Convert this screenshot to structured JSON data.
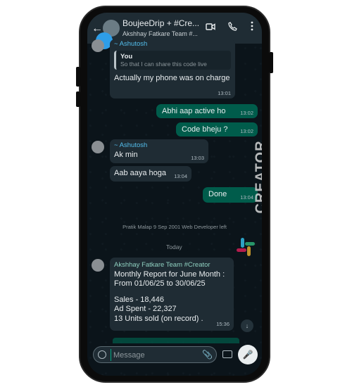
{
  "header": {
    "title": "BoujeeDrip + #Cre...",
    "subtitle": "Akshhay Fatkare Team #..."
  },
  "messages": {
    "m1": {
      "sender": "~ Ashutosh",
      "quote_author": "You",
      "quote_text": "So that I can share this code live",
      "text": "Actually my phone was on charge",
      "time": "13:01"
    },
    "m2": {
      "text": "Abhi aap active ho",
      "time": "13:02"
    },
    "m3": {
      "text": "Code bheju ?",
      "time": "13:02"
    },
    "m4": {
      "sender": "~ Ashutosh",
      "text": "Ak min",
      "time": "13:03"
    },
    "m5": {
      "text": "Aab aaya hoga",
      "time": "13:04"
    },
    "m6": {
      "text": "Done",
      "time": "13:04"
    },
    "system": "Pratik Malap 9 Sep 2001 Web Developer left",
    "day": "Today",
    "m7": {
      "sender": "Akshhay Fatkare Team #Creator",
      "line1": "Monthly Report for June Month :",
      "line2": "From 01/06/25 to 30/06/25",
      "line3": "Sales - 18,446",
      "line4": "Ad Spent - 22,327",
      "line5": "13 Units sold (on record) .",
      "time": "15:36"
    }
  },
  "watermark": "CREATOR",
  "composer": {
    "placeholder": "Message"
  },
  "icons": {
    "back": "arrow-left-icon",
    "video": "video-camera-icon",
    "call": "phone-icon",
    "menu": "more-vertical-icon",
    "scroll": "chevron-double-down-icon",
    "emoji": "emoji-icon",
    "attach": "paperclip-icon",
    "camera": "camera-icon",
    "mic": "microphone-icon"
  },
  "colors": {
    "incoming": "#1f2c34",
    "outgoing": "#005c4b",
    "background": "#0b141a",
    "accent": "#53bdeb"
  }
}
